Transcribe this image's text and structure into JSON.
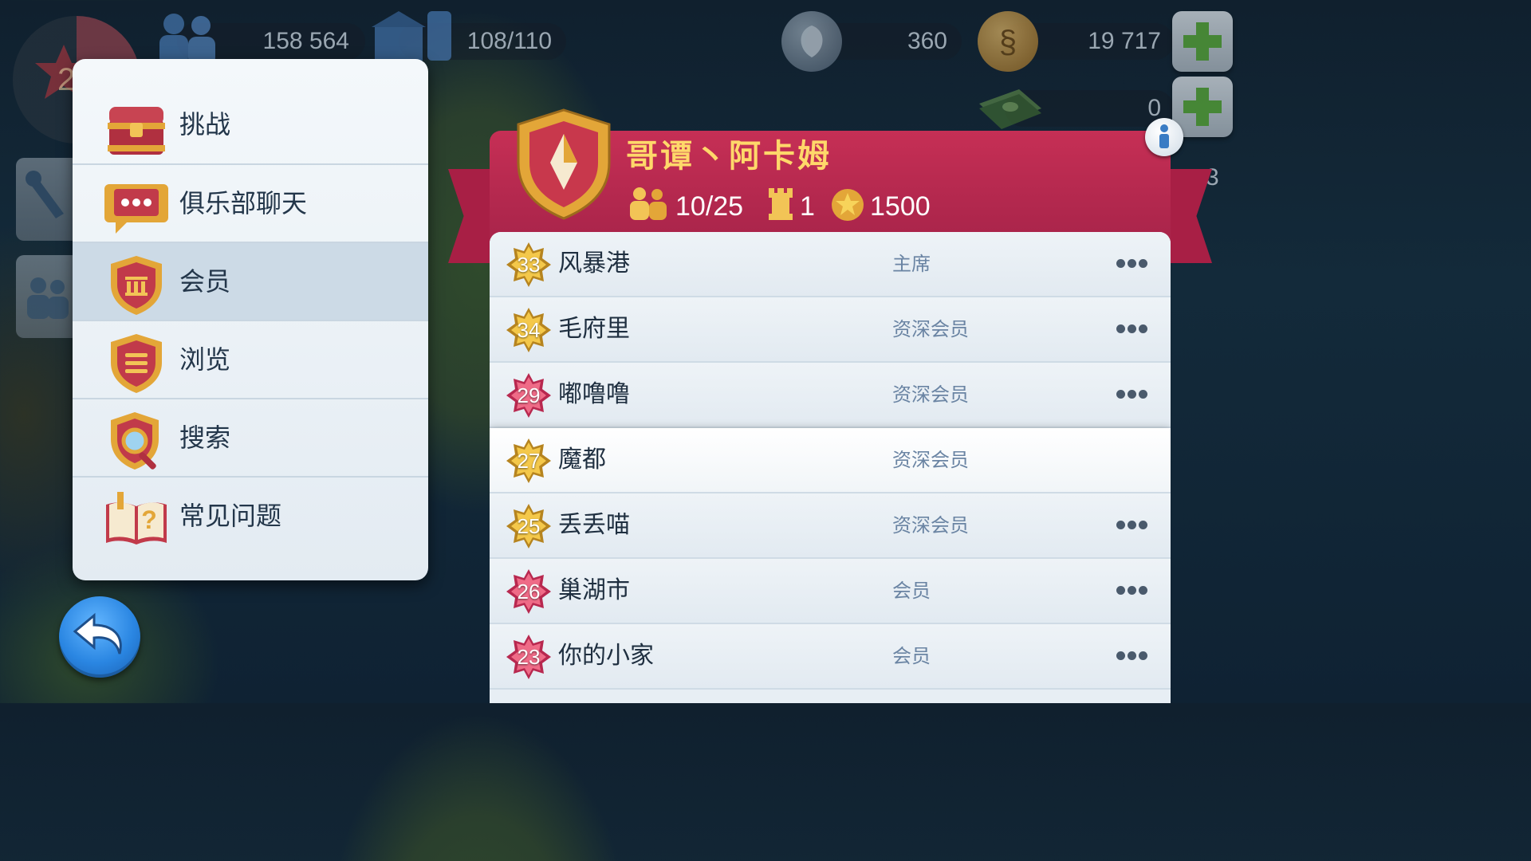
{
  "hud": {
    "population": "158 564",
    "storage": "108/110",
    "neosimoleons": "360",
    "simoleons": "19 717",
    "simcash": "0",
    "level_partial": "2",
    "side_count_partial": "3",
    "icons": [
      "population-icon",
      "storage-icon",
      "leaf-coin-icon",
      "simoleon-coin-icon",
      "cash-stack-icon",
      "plus-icon"
    ]
  },
  "menu": {
    "items": [
      {
        "label": "挑战",
        "icon": "treasure-chest-icon"
      },
      {
        "label": "俱乐部聊天",
        "icon": "chat-bubble-icon"
      },
      {
        "label": "会员",
        "icon": "member-shield-icon"
      },
      {
        "label": "浏览",
        "icon": "browse-shield-icon"
      },
      {
        "label": "搜索",
        "icon": "search-shield-icon"
      },
      {
        "label": "常见问题",
        "icon": "faq-book-icon"
      }
    ],
    "selected_index": 2
  },
  "club": {
    "name": "哥谭丶阿卡姆",
    "members": "10/25",
    "wars": "1",
    "points": "1500",
    "colors": {
      "banner": "#b8284f",
      "name": "#ffd86a"
    }
  },
  "members": [
    {
      "level": "33",
      "name": "风暴港",
      "role": "主席",
      "badge": "gold"
    },
    {
      "level": "34",
      "name": "毛府里",
      "role": "资深会员",
      "badge": "gold"
    },
    {
      "level": "29",
      "name": "嘟噜噜",
      "role": "资深会员",
      "badge": "pink"
    },
    {
      "level": "27",
      "name": "魔都",
      "role": "资深会员",
      "badge": "gold"
    },
    {
      "level": "25",
      "name": "丢丢喵",
      "role": "资深会员",
      "badge": "gold"
    },
    {
      "level": "26",
      "name": "巢湖市",
      "role": "会员",
      "badge": "pink"
    },
    {
      "level": "23",
      "name": "你的小家",
      "role": "会员",
      "badge": "pink"
    }
  ]
}
